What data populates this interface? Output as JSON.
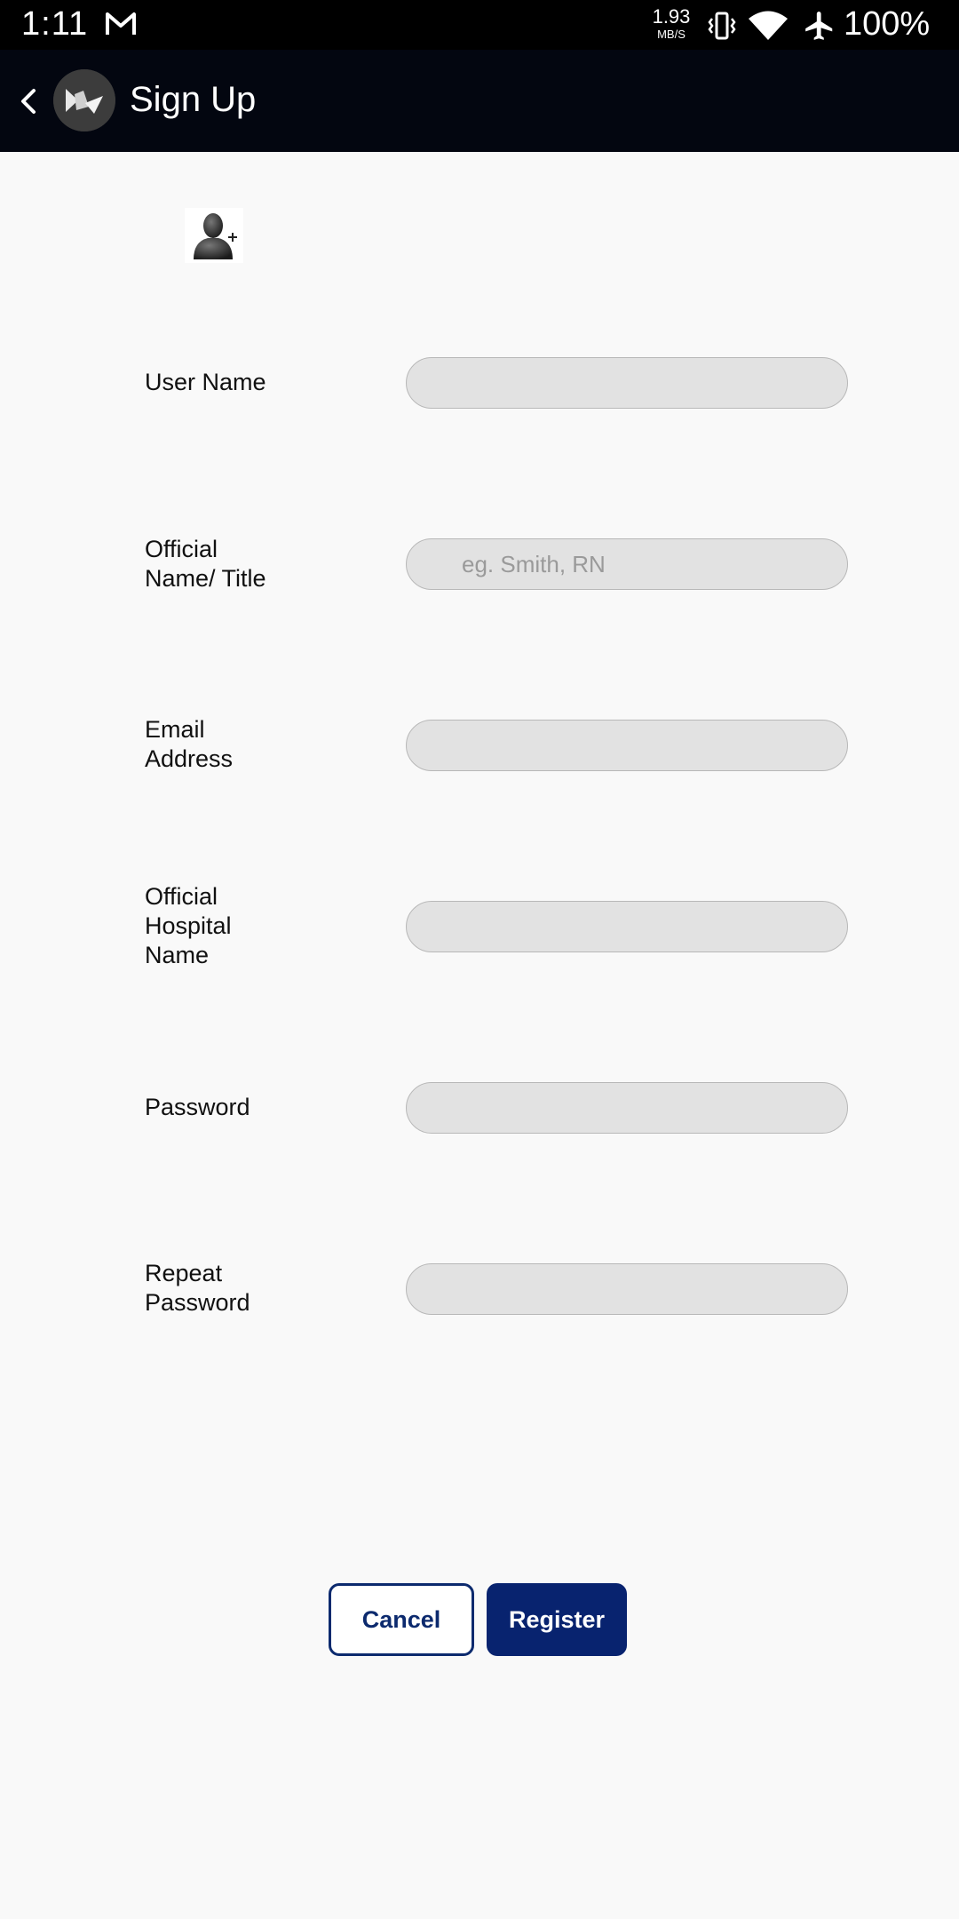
{
  "status_bar": {
    "time": "1:11",
    "net_speed_value": "1.93",
    "net_speed_unit": "MB/S",
    "battery": "100%"
  },
  "app_bar": {
    "title": "Sign Up"
  },
  "form": {
    "fields": [
      {
        "label": "User Name",
        "placeholder": "",
        "value": ""
      },
      {
        "label": "Official\nName/ Title",
        "placeholder": "eg. Smith, RN",
        "value": ""
      },
      {
        "label": "Email\nAddress",
        "placeholder": "",
        "value": ""
      },
      {
        "label": "Official\nHospital\nName",
        "placeholder": "",
        "value": ""
      },
      {
        "label": "Password",
        "placeholder": "",
        "value": ""
      },
      {
        "label": "Repeat\nPassword",
        "placeholder": "",
        "value": ""
      }
    ]
  },
  "buttons": {
    "cancel": "Cancel",
    "register": "Register"
  },
  "icons": {
    "status": [
      "gmail-icon",
      "vibrate-icon",
      "wifi-icon",
      "airplane-icon"
    ],
    "app_bar": [
      "back-arrow-icon",
      "app-logo-icon"
    ],
    "form": [
      "add-user-icon"
    ]
  },
  "colors": {
    "status_bar": "#000000",
    "app_bar": "#030610",
    "background": "#f9f9f9",
    "input_fill": "#e2e2e2",
    "button_primary": "#08236f",
    "button_outline": "#0c2a6e"
  }
}
